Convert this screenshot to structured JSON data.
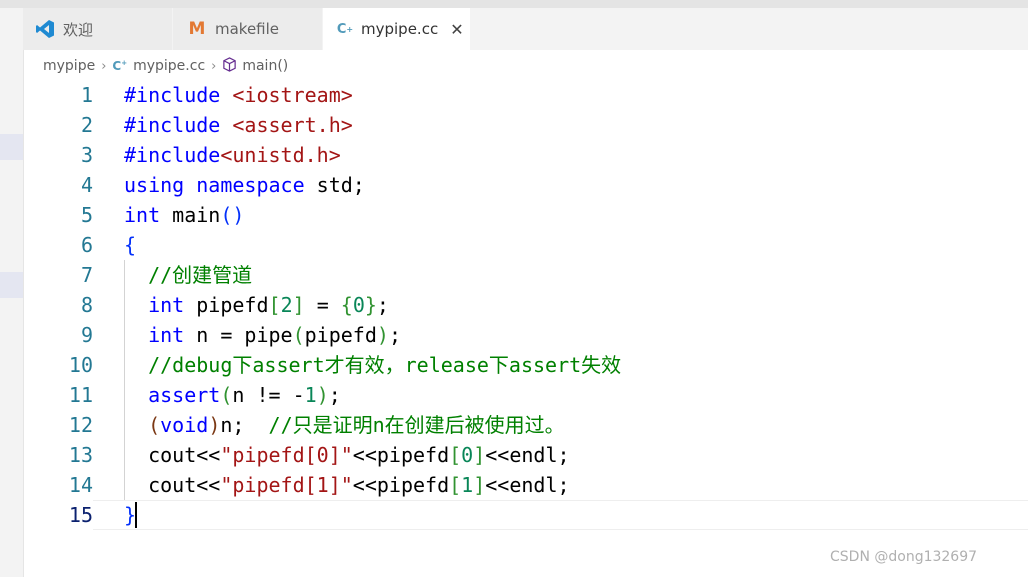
{
  "tabs": [
    {
      "label": "欢迎",
      "icon": "vscode-logo-icon"
    },
    {
      "label": "makefile",
      "icon": "makefile-m-icon"
    },
    {
      "label": "mypipe.cc",
      "icon": "cpp-file-icon",
      "active": true
    }
  ],
  "breadcrumb": {
    "folder": "mypipe",
    "file": "mypipe.cc",
    "symbol": "main()"
  },
  "editor": {
    "line_numbers": [
      "1",
      "2",
      "3",
      "4",
      "5",
      "6",
      "7",
      "8",
      "9",
      "10",
      "11",
      "12",
      "13",
      "14",
      "15"
    ],
    "current_line": "15",
    "code": {
      "l1_directive": "#include",
      "l1_header": " <iostream>",
      "l2_directive": "#include",
      "l2_header": " <assert.h>",
      "l3_directive": "#include",
      "l3_header": "<unistd.h>",
      "l4_using": "using",
      "l4_namespace": "namespace",
      "l4_rest": " std;",
      "l5_type": "int",
      "l5_name": " main",
      "l5_parens": "()",
      "l6_brace": "{",
      "l7_comment": "//创建管道",
      "l8_type": "int",
      "l8_name": " pipefd",
      "l8_lb": "[",
      "l8_size": "2",
      "l8_rb": "]",
      "l8_eq": " = ",
      "l8_lc": "{",
      "l8_zero": "0",
      "l8_rc": "}",
      "l8_end": ";",
      "l9_type": "int",
      "l9_mid": " n = pipe",
      "l9_lp": "(",
      "l9_arg": "pipefd",
      "l9_rp": ")",
      "l9_end": ";",
      "l10_comment": "//debug下assert才有效，release下assert失效",
      "l11_fn": "assert",
      "l11_lp": "(",
      "l11_mid": "n != -",
      "l11_num": "1",
      "l11_rp": ")",
      "l11_end": ";",
      "l12_lp": "(",
      "l12_void": "void",
      "l12_rp": ")",
      "l12_mid": "n;  ",
      "l12_comment": "//只是证明n在创建后被使用过。",
      "l13_a": "cout<<",
      "l13_str": "\"pipefd[0]\"",
      "l13_b": "<<pipefd",
      "l13_lb": "[",
      "l13_idx": "0",
      "l13_rb": "]",
      "l13_c": "<<endl;",
      "l14_a": "cout<<",
      "l14_str": "\"pipefd[1]\"",
      "l14_b": "<<pipefd",
      "l14_lb": "[",
      "l14_idx": "1",
      "l14_rb": "]",
      "l14_c": "<<endl;",
      "l15_brace": "}"
    }
  },
  "watermark": "CSDN @dong132697",
  "colors": {
    "keyword": "#0000ff",
    "string": "#a31515",
    "number": "#098658",
    "comment": "#008000",
    "line_number": "#237893"
  }
}
